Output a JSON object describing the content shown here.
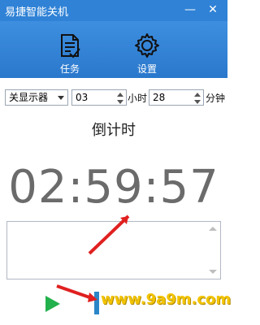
{
  "window": {
    "title": "易捷智能关机"
  },
  "toolbar": {
    "task_label": "任务",
    "settings_label": "设置"
  },
  "controls": {
    "action_select": {
      "value": "关显示器"
    },
    "hours": {
      "value": "03",
      "unit": "小时"
    },
    "minutes": {
      "value": "28",
      "unit": "分钟"
    }
  },
  "countdown": {
    "label": "倒计时",
    "time": "02:59:57"
  },
  "watermark": {
    "text": "www.9a9m.com"
  },
  "colors": {
    "titlebar": "#2f82d6",
    "toolbar": "#2a78cc",
    "start": "#22b14c",
    "annotation": "#e02020",
    "watermark": "#f3c400"
  }
}
